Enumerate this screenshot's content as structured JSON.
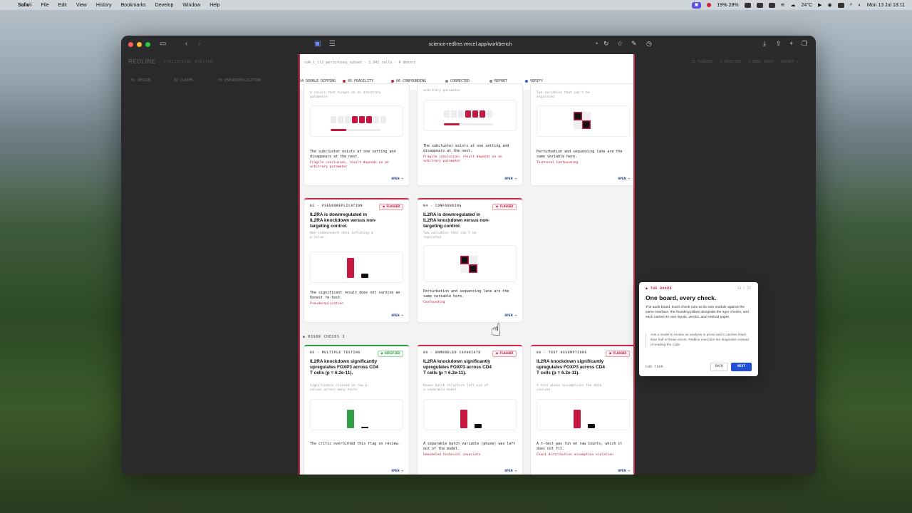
{
  "menubar": {
    "apple": "",
    "items": [
      "Safari",
      "File",
      "Edit",
      "View",
      "History",
      "Bookmarks",
      "Develop",
      "Window",
      "Help"
    ],
    "battery": "19%·28%",
    "weather": "24°C",
    "clock": "Mon 13 Jul  18:11"
  },
  "browser": {
    "url": "science-redline.vercel.app/workbench"
  },
  "app": {
    "logo": "REDLINE",
    "subtitle": "STATISTICAL AUDITOR",
    "dataset": "cd4_t_il2_perturbseq_subset · 2,941 cells · 4 donors",
    "header_right": [
      "33 FLAGGED",
      "1 VERIFIED",
      "0 NEED INPUT",
      "REPORT ▾"
    ],
    "steps_dim": [
      "01 DESIGN",
      "02 CLAIMS",
      "03 PSEUDOREPLICATION"
    ],
    "steps": [
      "04 DOUBLE DIPPING",
      "05 FRAGILITY",
      "06 CONFOUNDING",
      "CORRECTED",
      "REPORT",
      "VERIFY"
    ],
    "colors": {
      "accent": "#d02947",
      "verified": "#2f9e44",
      "primary": "#1f4fd6"
    }
  },
  "cards_top": [
    {
      "sub": "A result that hinges on an arbitrary parameter",
      "desc": "The subcluster exists at one setting and disappears at the next.",
      "note": "Fragile conclusion, result depends on an arbitrary parameter",
      "open": "OPEN →"
    },
    {
      "sub": "arbitrary parameter",
      "desc": "The subcluster exists at one setting and disappears at the next.",
      "note": "Fragile conclusion, result depends on an arbitrary parameter",
      "open": "OPEN →"
    },
    {
      "sub": "Two variables that can't be separated",
      "desc": "Perturbation and sequencing lane are the same variable here.",
      "note": "Technical Confounding",
      "open": "OPEN →"
    }
  ],
  "cards_mid": [
    {
      "eyebrow": "01 · PSEUDOREPLICATION",
      "badge": "● FLAGGED",
      "title": "IL2RA is downregulated in IL2RA knockdown versus non-targeting control.",
      "sub": "Non-independent data inflating a p-value",
      "desc": "The significant result does not survive an honest re-test.",
      "note": "Pseudoreplication",
      "open": "OPEN →"
    },
    {
      "eyebrow": "04 · CONFOUNDING",
      "badge": "● FLAGGED",
      "title": "IL2RA is downregulated in IL2RA knockdown versus non-targeting control.",
      "sub": "Two variables that can't be separated",
      "desc": "Perturbation and sequencing lane are the same variable here.",
      "note": "Confounding",
      "open": "OPEN →"
    }
  ],
  "section_label": "● RIGOR CHECKS  3",
  "cards_bottom": [
    {
      "eyebrow": "05 · MULTIPLE TESTING",
      "badge": "● VERIFIED",
      "title": "IL2RA knockdown significantly upregulates FOXP3 across CD4 T cells (p = 6.2e-11).",
      "sub": "Significance claimed on raw p-values across many tests",
      "desc": "The critic overturned this flag on review.",
      "note": "",
      "open": "OPEN →"
    },
    {
      "eyebrow": "06 · UNMODELED COVARIATE",
      "badge": "● FLAGGED",
      "title": "IL2RA knockdown significantly upregulates FOXP3 across CD4 T cells (p = 6.2e-11).",
      "sub": "Known batch structure left out of a separable model",
      "desc": "A separable batch variable (phase) was left out of the model.",
      "note": "Unmodeled technical covariate",
      "open": "OPEN →"
    },
    {
      "eyebrow": "08 · TEST ASSUMPTIONS",
      "badge": "● FLAGGED",
      "title": "IL2RA knockdown significantly upregulates FOXP3 across CD4 T cells (p = 6.2e-11).",
      "sub": "A test whose assumptions the data violate",
      "desc": "A t-test was run on raw counts, which it does not fit.",
      "note": "Count distribution assumption violation",
      "open": "OPEN →"
    }
  ],
  "tour": {
    "eyebrow": "● THE BOARD",
    "count": "13 / 25",
    "title": "One board, every check.",
    "body": "The audit board. Each check runs as its own module against the same interface, the founding pillars alongside the rigor checks, and each carries its own inputs, verdict, and method paper.",
    "quote": "Ask a model to review an analysis in prose and it catches fewer than half of these errors. Redline executes the diagnostic instead of reading the code.",
    "end": "END TOUR",
    "back": "BACK",
    "next": "NEXT"
  }
}
